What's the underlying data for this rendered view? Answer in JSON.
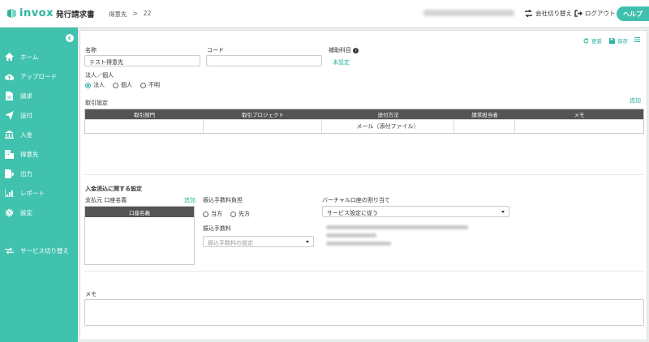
{
  "header": {
    "logo_text": "invox",
    "logo_sub": "発行請求書",
    "breadcrumb": [
      "得意先",
      ">",
      "22"
    ],
    "company_switch": "会社切り替え",
    "logout": "ログアウト",
    "help": "ヘルプ"
  },
  "sidebar": {
    "items": [
      {
        "label": "ホーム",
        "icon": "home-icon"
      },
      {
        "label": "アップロード",
        "icon": "cloud-upload-icon"
      },
      {
        "label": "請求",
        "icon": "document-icon"
      },
      {
        "label": "送付",
        "icon": "send-icon"
      },
      {
        "label": "入金",
        "icon": "bank-icon"
      },
      {
        "label": "得意先",
        "icon": "building-icon"
      },
      {
        "label": "出力",
        "icon": "export-icon"
      },
      {
        "label": "レポート",
        "icon": "chart-icon"
      },
      {
        "label": "設定",
        "icon": "gear-icon"
      },
      {
        "label": "サービス切り替え",
        "icon": "switch-icon"
      }
    ]
  },
  "toolbar": {
    "refresh": "更新",
    "save": "保存"
  },
  "form": {
    "name_label": "名称",
    "name_value": "テスト得意先",
    "code_label": "コード",
    "code_value": "",
    "subaccount_label": "補助科目",
    "subaccount_value": "未設定",
    "entity_label": "法人／個人",
    "entity_options": [
      "法人",
      "個人",
      "不明"
    ]
  },
  "transactions": {
    "title": "取引設定",
    "add": "追加",
    "columns": [
      "取引部門",
      "取引プロジェクト",
      "送付方法",
      "請求担当者",
      "メモ"
    ],
    "rows": [
      [
        "",
        "",
        "メール（添付ファイル）",
        "",
        ""
      ]
    ]
  },
  "payment": {
    "title": "入金消込に関する設定",
    "account_label": "支払元 口座名義",
    "account_add": "追加",
    "account_header": "口座名義",
    "fee_burden_label": "振込手数料負担",
    "fee_burden_options": [
      "当方",
      "先方"
    ],
    "fee_label": "振込手数料",
    "fee_placeholder": "振込手数料の設定",
    "virtual_label": "バーチャル口座の割り当て",
    "virtual_value": "サービス設定に従う"
  },
  "memo": {
    "label": "メモ",
    "value": ""
  },
  "colors": {
    "accent": "#41c2ae",
    "link": "#2bb3a0",
    "table_header": "#545454"
  }
}
